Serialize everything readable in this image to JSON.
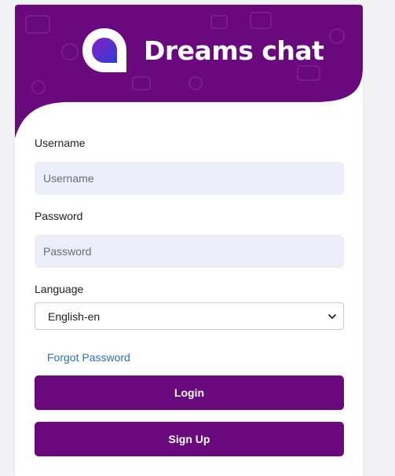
{
  "brand": {
    "name": "Dreams chat",
    "logo_icon": "chat-bubble-logo-icon"
  },
  "colors": {
    "primary": "#6a097d",
    "input_bg": "#ebedf8",
    "link": "#2f6fc6"
  },
  "form": {
    "username": {
      "label": "Username",
      "placeholder": "Username",
      "value": ""
    },
    "password": {
      "label": "Password",
      "placeholder": "Password",
      "value": ""
    },
    "language": {
      "label": "Language",
      "selected": "English-en",
      "icon": "chevron-down-icon"
    },
    "forgot_password": "Forgot Password",
    "login_label": "Login",
    "signup_label": "Sign Up"
  }
}
